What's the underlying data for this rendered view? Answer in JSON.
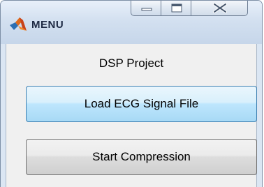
{
  "window": {
    "title": "MENU",
    "icon": "matlab-icon",
    "controls": {
      "minimize_icon": "minimize-icon",
      "maximize_icon": "maximize-icon",
      "close_icon": "close-icon"
    }
  },
  "main": {
    "heading": "DSP Project",
    "buttons": {
      "load_label": "Load ECG Signal File",
      "start_label": "Start Compression"
    }
  },
  "colors": {
    "hover_button_border": "#3c7fb1",
    "hover_button_fill": "#bee6fd",
    "window_frame": "#dbe6f3"
  }
}
